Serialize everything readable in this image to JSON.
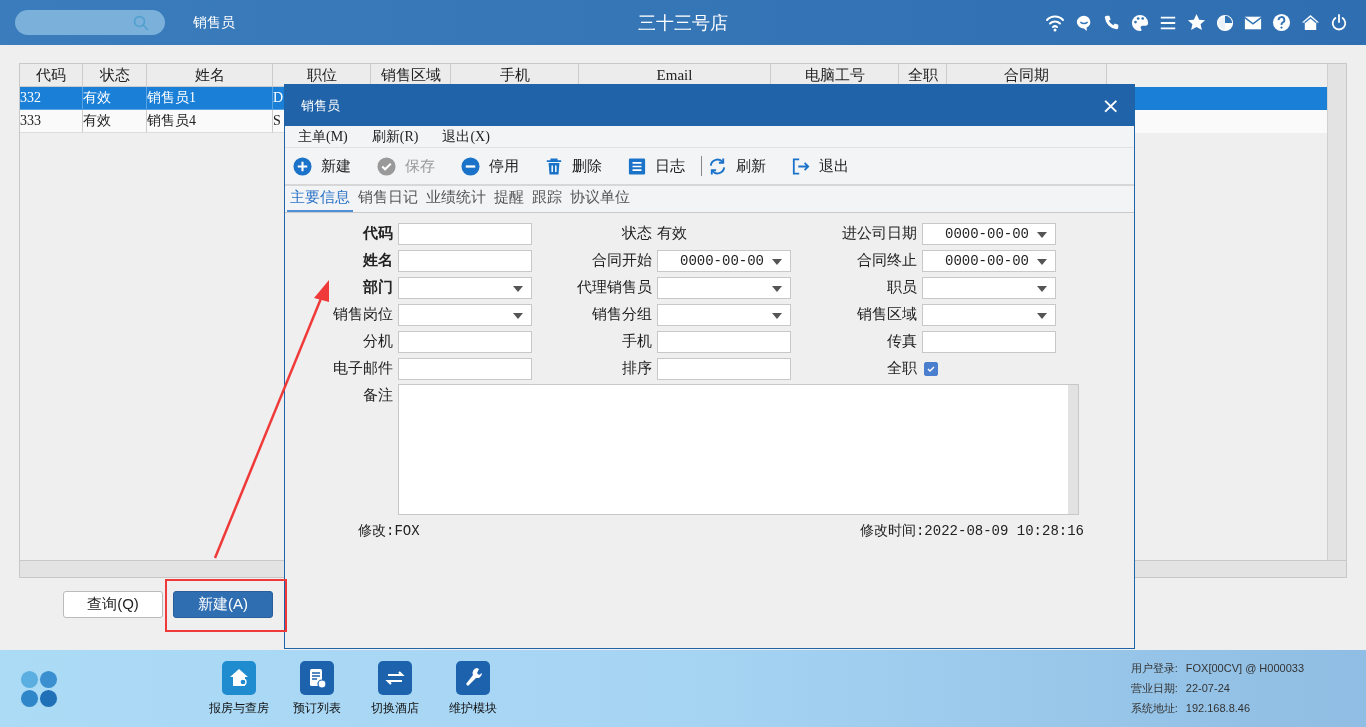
{
  "header": {
    "page_title": "销售员",
    "store": "三十三号店"
  },
  "table": {
    "columns": [
      "代码",
      "状态",
      "姓名",
      "职位",
      "销售区域",
      "手机",
      "Email",
      "电脑工号",
      "全职",
      "合同期"
    ],
    "rows": [
      {
        "selected": true,
        "cells": [
          "332",
          "有效",
          "销售员1",
          "D"
        ]
      },
      {
        "selected": false,
        "cells": [
          "333",
          "有效",
          "销售员4",
          "S"
        ]
      }
    ]
  },
  "buttons": [
    {
      "label": "查询(Q)",
      "kind": "default"
    },
    {
      "label": "新建(A)",
      "kind": "primary"
    }
  ],
  "dialog": {
    "title": "销售员",
    "close": "×",
    "menu": [
      "主单(M)",
      "刷新(R)",
      "退出(X)"
    ],
    "toolbar": [
      {
        "label": "新建",
        "kind": "plus",
        "disabled": false
      },
      {
        "label": "保存",
        "kind": "check",
        "disabled": true
      },
      {
        "label": "停用",
        "kind": "minus",
        "disabled": false
      },
      {
        "label": "删除",
        "kind": "trash",
        "disabled": false
      },
      {
        "label": "日志",
        "kind": "list",
        "disabled": false
      },
      {
        "kind": "separator"
      },
      {
        "label": "刷新",
        "kind": "refresh",
        "disabled": false
      },
      {
        "label": "退出",
        "kind": "exit",
        "disabled": false
      }
    ],
    "tabs": [
      {
        "label": "主要信息",
        "selected": true
      },
      {
        "label": "销售日记",
        "selected": false
      },
      {
        "label": "业绩统计",
        "selected": false
      },
      {
        "label": "提醒",
        "selected": false
      },
      {
        "label": "跟踪",
        "selected": false
      },
      {
        "label": "协议单位",
        "selected": false
      }
    ],
    "fields": [
      {
        "label": "代码",
        "bold": true,
        "kind": "text"
      },
      {
        "label": "状态",
        "bold": false,
        "kind": "status",
        "value": "有效"
      },
      {
        "label": "进公司日期",
        "bold": false,
        "kind": "date",
        "value": "0000-00-00"
      },
      {
        "label": "姓名",
        "bold": true,
        "kind": "text"
      },
      {
        "label": "合同开始",
        "bold": false,
        "kind": "date",
        "value": "0000-00-00"
      },
      {
        "label": "合同终止",
        "bold": false,
        "kind": "date",
        "value": "0000-00-00"
      },
      {
        "label": "部门",
        "bold": true,
        "kind": "select"
      },
      {
        "label": "代理销售员",
        "bold": false,
        "kind": "select"
      },
      {
        "label": "职员",
        "bold": false,
        "kind": "select"
      },
      {
        "label": "销售岗位",
        "bold": false,
        "kind": "select"
      },
      {
        "label": "销售分组",
        "bold": false,
        "kind": "select"
      },
      {
        "label": "销售区域",
        "bold": false,
        "kind": "select"
      },
      {
        "label": "分机",
        "bold": false,
        "kind": "text"
      },
      {
        "label": "手机",
        "bold": false,
        "kind": "text"
      },
      {
        "label": "传真",
        "bold": false,
        "kind": "text"
      },
      {
        "label": "电子邮件",
        "bold": false,
        "kind": "text"
      },
      {
        "label": "排序",
        "bold": false,
        "kind": "text"
      },
      {
        "label": "全职",
        "bold": false,
        "kind": "checkbox",
        "checked": true
      }
    ],
    "remark_label": "备注",
    "modified_by": "修改:FOX",
    "modified_time": "修改时间:2022-08-09 10:28:16"
  },
  "taskbar": {
    "items": [
      {
        "label": "报房与查房",
        "kind": "house"
      },
      {
        "label": "预订列表",
        "kind": "doc"
      },
      {
        "label": "切换酒店",
        "kind": "swap"
      },
      {
        "label": "维护模块",
        "kind": "wrench"
      }
    ],
    "status": [
      {
        "label": "用户登录:",
        "value": "FOX[00CV] @ H000033"
      },
      {
        "label": "营业日期:",
        "value": "22-07-24"
      },
      {
        "label": "系统地址:",
        "value": "192.168.8.46"
      }
    ]
  }
}
